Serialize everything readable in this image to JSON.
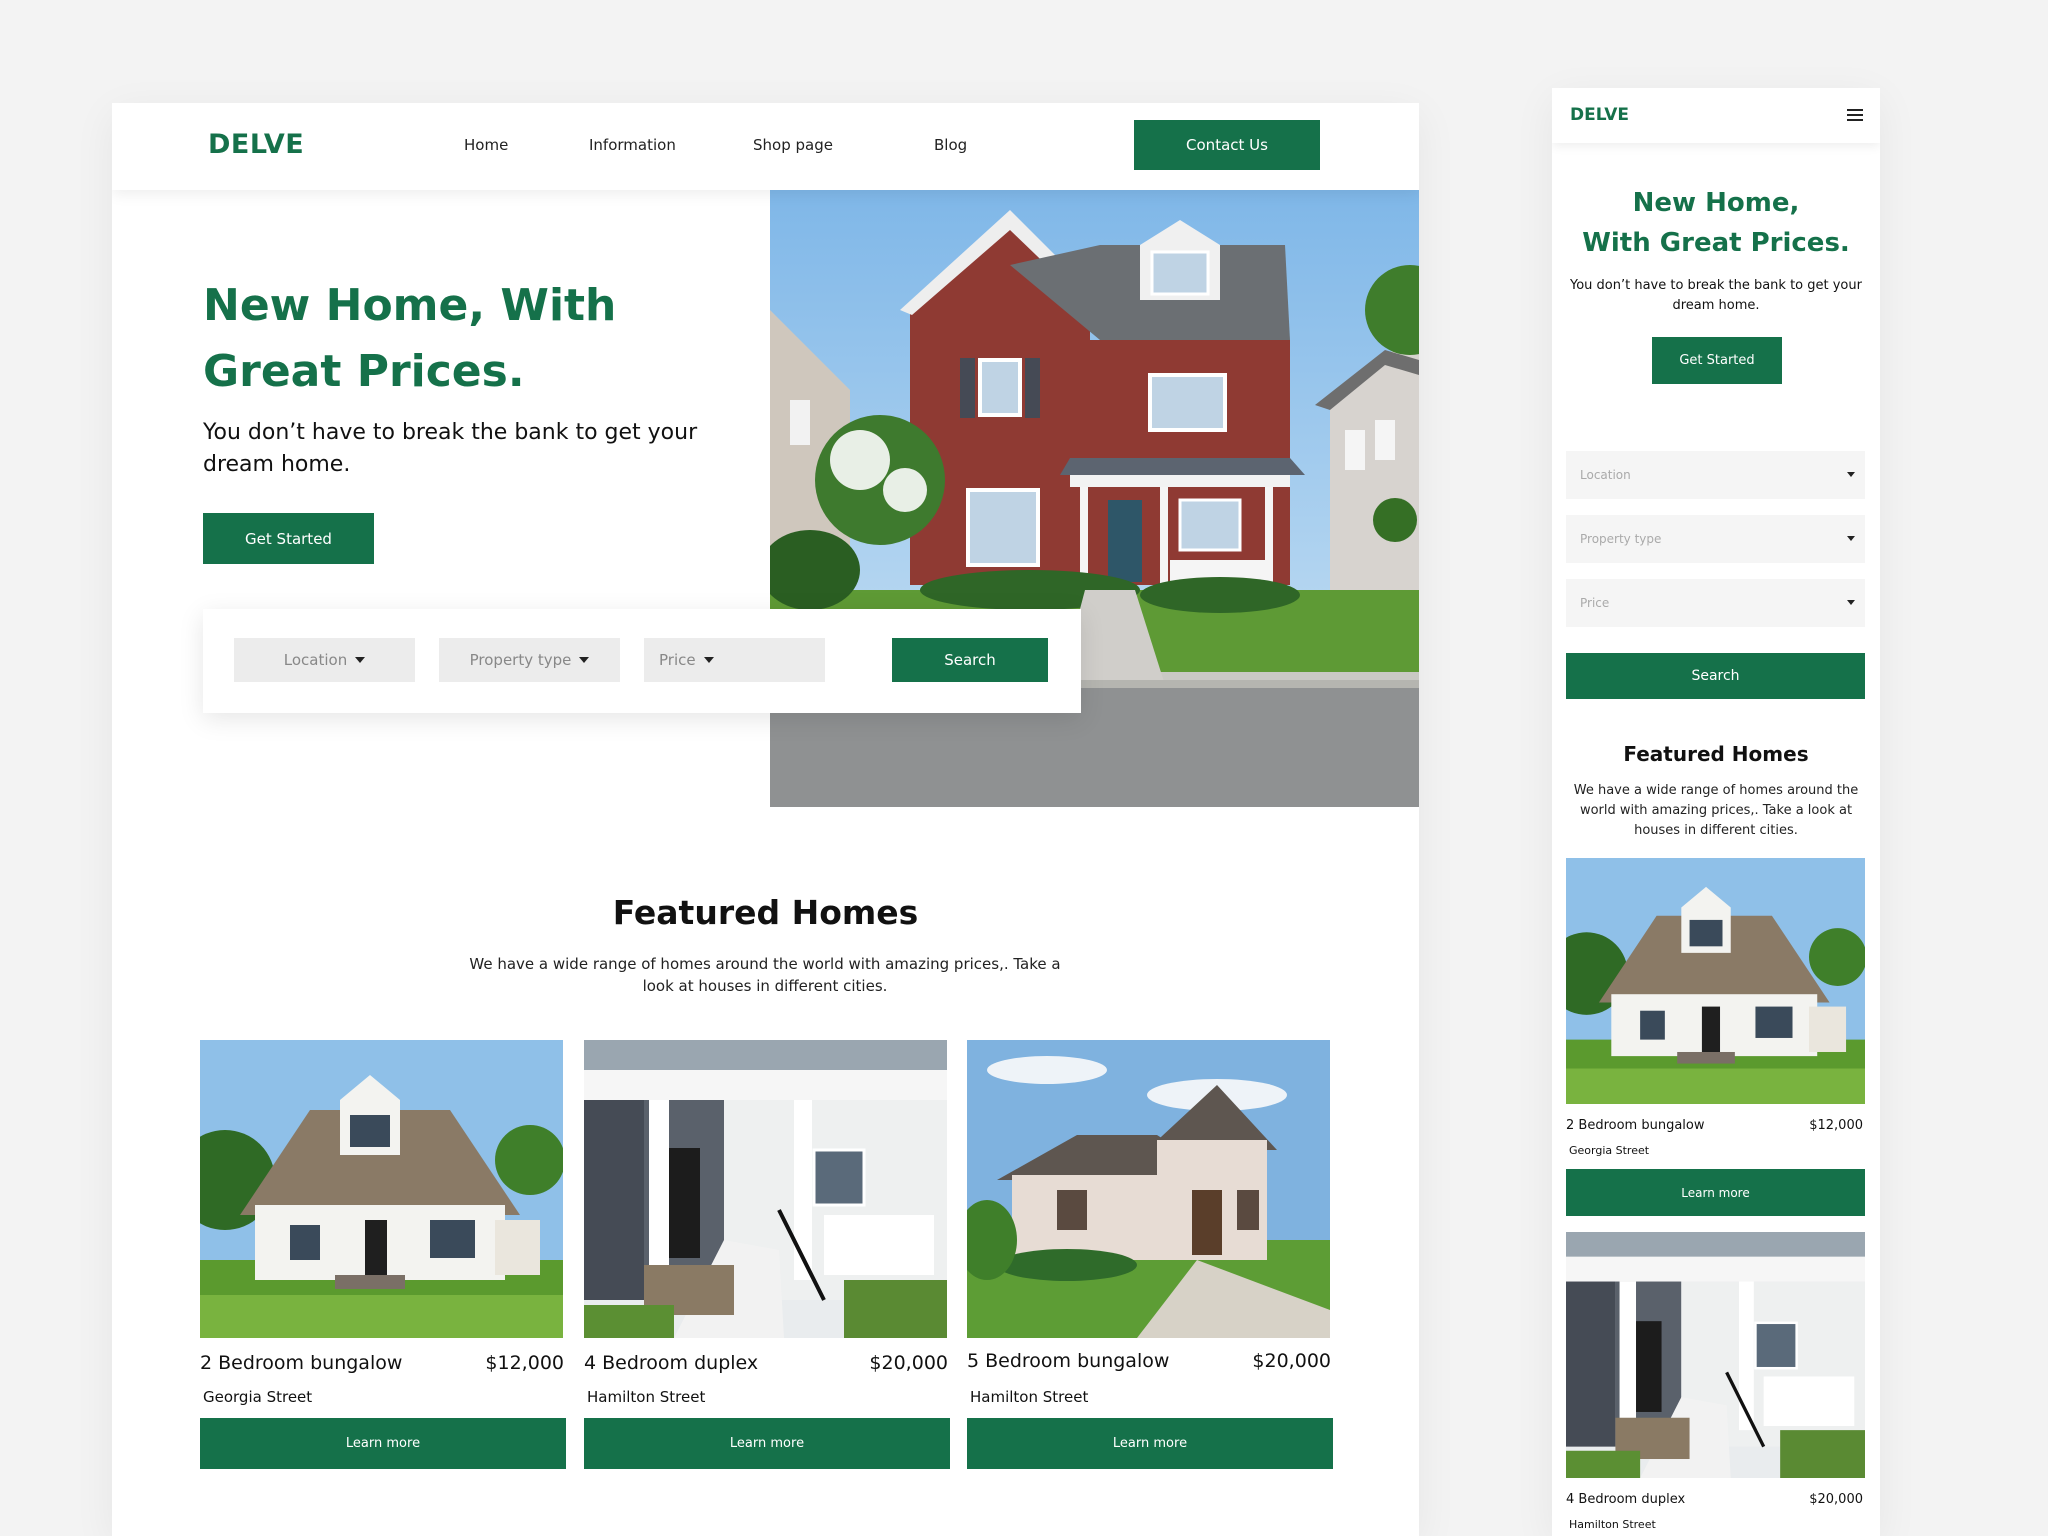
{
  "brand": {
    "logo": "DELVE",
    "accent_color": "#15714a"
  },
  "nav": {
    "links": [
      "Home",
      "Information",
      "Shop page",
      "Blog"
    ],
    "contact_label": "Contact Us",
    "menu_icon": "hamburger-menu-icon"
  },
  "hero": {
    "title_line1": "New Home, With",
    "title_line2": "Great Prices.",
    "subtitle": "You don’t have to break the bank to get your dream home.",
    "cta_label": "Get Started"
  },
  "mobile_hero": {
    "title_line1": "New Home,",
    "title_line2": "With Great Prices."
  },
  "search": {
    "location": "Location",
    "property_type": "Property type",
    "price": "Price",
    "button_label": "Search"
  },
  "featured": {
    "title": "Featured Homes",
    "description": "We have a wide range of homes around the world with amazing prices,. Take a look at houses in different cities.",
    "learn_more_label": "Learn more",
    "homes": [
      {
        "name": "2 Bedroom bungalow",
        "price": "$12,000",
        "street": "Georgia Street"
      },
      {
        "name": "4 Bedroom duplex",
        "price": "$20,000",
        "street": "Hamilton Street"
      },
      {
        "name": "5 Bedroom bungalow",
        "price": "$20,000",
        "street": "Hamilton Street"
      }
    ]
  }
}
